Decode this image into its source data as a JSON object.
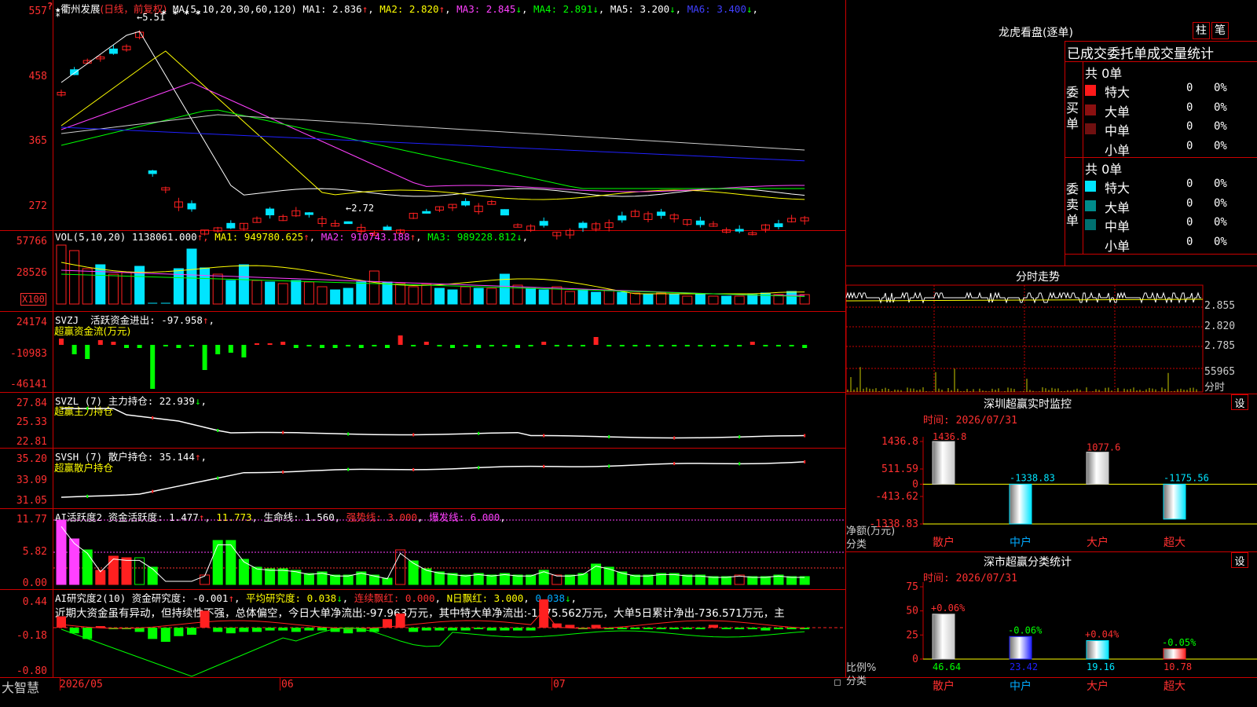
{
  "stock": {
    "star": "★",
    "name": "衢州发展",
    "period": "(日线，前复权)",
    "corner_marker": "?"
  },
  "colors": {
    "up": "#ff2020",
    "down": "#00e5ff",
    "grid": "#cc0000",
    "yellow": "#ffff00",
    "magenta": "#ff40ff",
    "green": "#00ff00",
    "blue": "#4040ff"
  },
  "kline": {
    "ma_label": "MA(5,10,20,30,60,120)",
    "ma_values": [
      {
        "label": "MA1: 2.836",
        "arrow": "↑",
        "color": "#ffffff"
      },
      {
        "label": "MA2: 2.820",
        "arrow": "↑",
        "color": "#ffff00"
      },
      {
        "label": "MA3: 2.845",
        "arrow": "↓",
        "color": "#ff40ff"
      },
      {
        "label": "MA4: 2.891",
        "arrow": "↓",
        "color": "#00ff00"
      },
      {
        "label": "MA5: 3.200",
        "arrow": "↓",
        "color": "#ffffff"
      },
      {
        "label": "MA6: 3.400",
        "arrow": "↓",
        "color": "#4040ff"
      }
    ],
    "y_axis": [
      "557",
      "458",
      "365",
      "272"
    ],
    "high_marker": "5.51",
    "low_marker": "2.72",
    "stars": "* * * *"
  },
  "vol": {
    "title": "VOL(5,10,20)",
    "value": "1138061.000",
    "ma": [
      {
        "label": "MA1: 949780.625",
        "arrow": "↑",
        "color": "#ffff00"
      },
      {
        "label": "MA2: 910743.188",
        "arrow": "↑",
        "color": "#ff40ff"
      },
      {
        "label": "MA3: 989228.812",
        "arrow": "↓",
        "color": "#00ff00"
      }
    ],
    "y_axis": [
      "57766",
      "28526"
    ],
    "unit": "X100"
  },
  "svzj": {
    "title": "SVZJ",
    "label": "活跃资金进出: -97.958",
    "arrow": "↑",
    "subtitle": "超赢资金流(万元)",
    "y_axis": [
      "24174",
      "-10983",
      "-46141"
    ]
  },
  "svzl": {
    "title": "SVZL (7)",
    "label": "主力持仓: 22.939",
    "arrow": "↓",
    "subtitle": "超赢主力持仓",
    "y_axis": [
      "27.84",
      "25.33",
      "22.81"
    ]
  },
  "svsh": {
    "title": "SVSH (7)",
    "label": "散户持仓: 35.144",
    "arrow": "↑",
    "subtitle": "超赢散户持仓",
    "y_axis": [
      "35.20",
      "33.09",
      "31.05"
    ]
  },
  "ai_active": {
    "title": "AI活跃度2",
    "items": [
      {
        "label": "资金活跃度: 1.477",
        "arrow": "↑",
        "color": "#ffffff"
      },
      {
        "label": "11.773",
        "arrow": "",
        "color": "#ffff00"
      },
      {
        "label": "生命线: 1.560",
        "arrow": "",
        "color": "#ffffff"
      },
      {
        "label": "强势线: 3.000",
        "arrow": "",
        "color": "#ff3030"
      },
      {
        "label": "爆发线: 6.000",
        "arrow": "",
        "color": "#ff40ff"
      }
    ],
    "y_axis": [
      "11.77",
      "5.82",
      "0.00"
    ]
  },
  "ai_research": {
    "title": "AI研究度2(10)",
    "items": [
      {
        "label": "资金研究度: -0.001",
        "arrow": "↑",
        "color": "#ffffff"
      },
      {
        "label": "平均研究度: 0.038",
        "arrow": "↓",
        "color": "#ffff00"
      },
      {
        "label": "连续飘红: 0.000",
        "arrow": "",
        "color": "#ff3030"
      },
      {
        "label": "N日飘红: 3.000",
        "arrow": "",
        "color": "#ffff00"
      },
      {
        "label": "0.038",
        "arrow": "↓",
        "color": "#00aaff"
      }
    ],
    "comment": "近期大资金虽有异动，但持续性不强，总体偏空，今日大单净流出:-97.963万元，其中特大单净流出:-1175.562万元，大单5日累计净出-736.571万元，主",
    "y_axis": [
      "0.44",
      "-0.18",
      "-0.80"
    ]
  },
  "bottom_bar": {
    "logo": "大智慧",
    "dates": [
      "2026/05",
      "06",
      "07"
    ]
  },
  "right": {
    "dragon": {
      "title": "龙虎看盘(逐单)",
      "tabs": [
        "柱",
        "笔"
      ],
      "header": "已成交委托单成交量统计",
      "buy": {
        "side": "委\n买\n单",
        "total": "共 0单",
        "rows": [
          {
            "name": "特大",
            "count": "0",
            "pct": "0%",
            "color": "#ff1a1a"
          },
          {
            "name": "大单",
            "count": "0",
            "pct": "0%",
            "color": "#8b1010"
          },
          {
            "name": "中单",
            "count": "0",
            "pct": "0%",
            "color": "#701010"
          },
          {
            "name": "小单",
            "count": "0",
            "pct": "0%",
            "color": ""
          }
        ]
      },
      "sell": {
        "side": "委\n卖\n单",
        "total": "共 0单",
        "rows": [
          {
            "name": "特大",
            "count": "0",
            "pct": "0%",
            "color": "#00e5ff"
          },
          {
            "name": "大单",
            "count": "0",
            "pct": "0%",
            "color": "#008b8b"
          },
          {
            "name": "中单",
            "count": "0",
            "pct": "0%",
            "color": "#007070"
          },
          {
            "name": "小单",
            "count": "0",
            "pct": "0%",
            "color": ""
          }
        ]
      }
    },
    "minute": {
      "title": "分时走势",
      "y_axis": [
        "2.855",
        "2.820",
        "2.785"
      ],
      "vol_label": "55965",
      "footer": "分时"
    },
    "sz_monitor": {
      "title": "深圳超赢实时监控",
      "setting": "设",
      "time": "时间: 2026/07/31",
      "y_axis": [
        "1436.8",
        "511.59",
        "0",
        "-413.62",
        "-1338.83"
      ],
      "axis_title": "净额(万元)",
      "cat_title": "分类",
      "categories": [
        "散户",
        "中户",
        "大户",
        "超大"
      ]
    },
    "sz_category": {
      "title": "深市超赢分类统计",
      "setting": "设",
      "time": "时间: 2026/07/31",
      "y_axis": [
        "75",
        "50",
        "25",
        "0"
      ],
      "axis_title": "比例%",
      "cat_title": "分类",
      "categories": [
        "散户",
        "中户",
        "大户",
        "超大"
      ]
    }
  },
  "chart_data": [
    {
      "type": "bar",
      "title": "深圳超赢实时监控",
      "categories": [
        "散户",
        "中户",
        "大户",
        "超大"
      ],
      "values": [
        1436.8,
        -1338.83,
        1077.6,
        -1175.56
      ],
      "ylabel": "净额(万元)",
      "ylim": [
        -1338.83,
        1436.8
      ],
      "colors": [
        "#c8c8c8",
        "#00e5ff",
        "#c8c8c8",
        "#00e5ff"
      ]
    },
    {
      "type": "bar",
      "title": "深市超赢分类统计",
      "categories": [
        "散户",
        "中户",
        "大户",
        "超大"
      ],
      "values": [
        46.64,
        23.42,
        19.16,
        10.78
      ],
      "changes": [
        "+0.06%",
        "-0.06%",
        "+0.04%",
        "-0.05%"
      ],
      "ylabel": "比例%",
      "ylim": [
        0,
        75
      ],
      "colors": [
        "#c8c8c8",
        "#2020ff",
        "#00e5ff",
        "#ff2020"
      ]
    }
  ]
}
